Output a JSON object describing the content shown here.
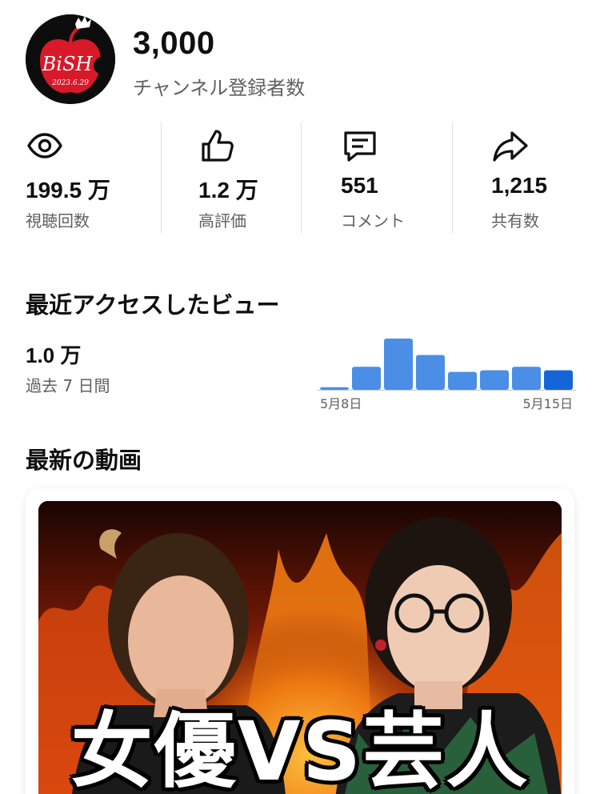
{
  "channel": {
    "avatar_text": "BiSH",
    "avatar_date": "2023.6.29",
    "subscriber_count": "3,000",
    "subscriber_label": "チャンネル登録者数"
  },
  "stats": [
    {
      "icon": "eye-icon",
      "value": "199.5 万",
      "label": "視聴回数"
    },
    {
      "icon": "thumbs-up-icon",
      "value": "1.2 万",
      "label": "高評価"
    },
    {
      "icon": "comment-icon",
      "value": "551",
      "label": "コメント"
    },
    {
      "icon": "share-icon",
      "value": "1,215",
      "label": "共有数"
    }
  ],
  "recent_views": {
    "title": "最近アクセスしたビュー",
    "value": "1.0 万",
    "period": "過去 7 日間"
  },
  "chart_data": {
    "type": "bar",
    "categories": [
      "5月8日",
      "",
      "",
      "",
      "",
      "",
      "",
      "5月15日"
    ],
    "values": [
      0.05,
      0.45,
      1.0,
      0.68,
      0.35,
      0.38,
      0.45,
      0.38
    ],
    "x_tick_labels": [
      "5月8日",
      "5月15日"
    ],
    "colors": {
      "bar": "#4a8ee6",
      "highlight": "#1565d8",
      "baseline": "#c8c8c8"
    },
    "highlight_index": 7,
    "grid": false,
    "legend": "none"
  },
  "latest_video": {
    "title": "最新の動画",
    "thumbnail_caption": "女優VS芸人"
  },
  "colors": {
    "text_primary": "#0f0f0f",
    "text_secondary": "#606060",
    "accent_red": "#d8192a"
  }
}
